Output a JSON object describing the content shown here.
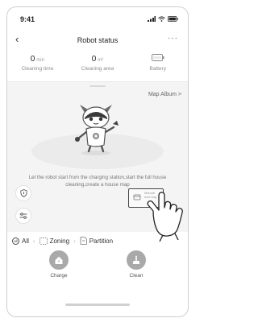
{
  "status_bar": {
    "time": "9:41"
  },
  "header": {
    "title": "Robot status",
    "back_icon": "‹",
    "more_icon": "···"
  },
  "stats": [
    {
      "value": "0",
      "unit": "min",
      "label": "Cleaning time"
    },
    {
      "value": "0",
      "unit": "m²",
      "label": "Cleaning area"
    },
    {
      "value": "",
      "unit": "",
      "label": "Battery",
      "icon": "battery-icon"
    }
  ],
  "map": {
    "album_link": "Map Album >",
    "message": "Let the robot start from the charging station,start the full house cleaning,create a house map",
    "bubble_text": "Manual dust bag"
  },
  "modes": [
    {
      "label": "All",
      "icon": "all-mode-icon"
    },
    {
      "label": "Zoning",
      "icon": "zoning-icon"
    },
    {
      "label": "Partition",
      "icon": "partition-icon"
    }
  ],
  "actions": {
    "charge_label": "Charge",
    "clean_label": "Clean"
  },
  "colors": {
    "action_gray": "#a9a9a9",
    "map_bg": "#f4f4f4"
  }
}
